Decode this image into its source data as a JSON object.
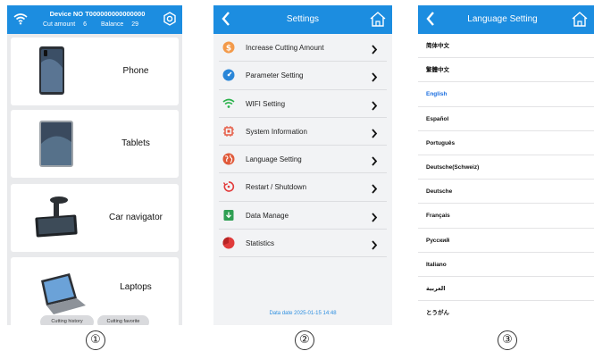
{
  "captions": [
    "①",
    "②",
    "③"
  ],
  "screen1": {
    "device_label": "Device NO T000000000000000",
    "cut_amount_label": "Cut amount",
    "cut_amount_value": "6",
    "balance_label": "Balance",
    "balance_value": "29",
    "categories": [
      {
        "label": "Phone",
        "icon": "phone-image"
      },
      {
        "label": "Tablets",
        "icon": "tablet-image"
      },
      {
        "label": "Car navigator",
        "icon": "car-navigator-image"
      },
      {
        "label": "Laptops",
        "icon": "laptop-image"
      }
    ],
    "bottom_buttons": [
      "Cutting history",
      "Cutting favorite"
    ]
  },
  "screen2": {
    "title": "Settings",
    "menu": [
      {
        "label": "Increase Cutting Amount",
        "icon": "dollar-icon",
        "color": "#f39a4a"
      },
      {
        "label": "Parameter Setting",
        "icon": "gauge-icon",
        "color": "#2a86d8"
      },
      {
        "label": "WIFI Setting",
        "icon": "wifi-icon",
        "color": "#2bb24c"
      },
      {
        "label": "System Information",
        "icon": "chip-icon",
        "color": "#e5533b"
      },
      {
        "label": "Language Setting",
        "icon": "globe-icon",
        "color": "#e05a3a"
      },
      {
        "label": "Restart / Shutdown",
        "icon": "restart-icon",
        "color": "#e23b3b"
      },
      {
        "label": "Data Manage",
        "icon": "download-icon",
        "color": "#2f9f53"
      },
      {
        "label": "Statistics",
        "icon": "pie-chart-icon",
        "color": "#e03b3b"
      }
    ],
    "data_date": "Data date  2025-01-15 14:48"
  },
  "screen3": {
    "title": "Language Setting",
    "languages": [
      "简体中文",
      "繁體中文",
      "English",
      "Español",
      "Português",
      "Deutsche(Schweiz)",
      "Deutsche",
      "Français",
      "Русский",
      "Italiano",
      "العربية",
      "とうがん"
    ],
    "selected": "English"
  },
  "colors": {
    "header": "#1c8de0",
    "selected_language": "#1c6fe0"
  }
}
